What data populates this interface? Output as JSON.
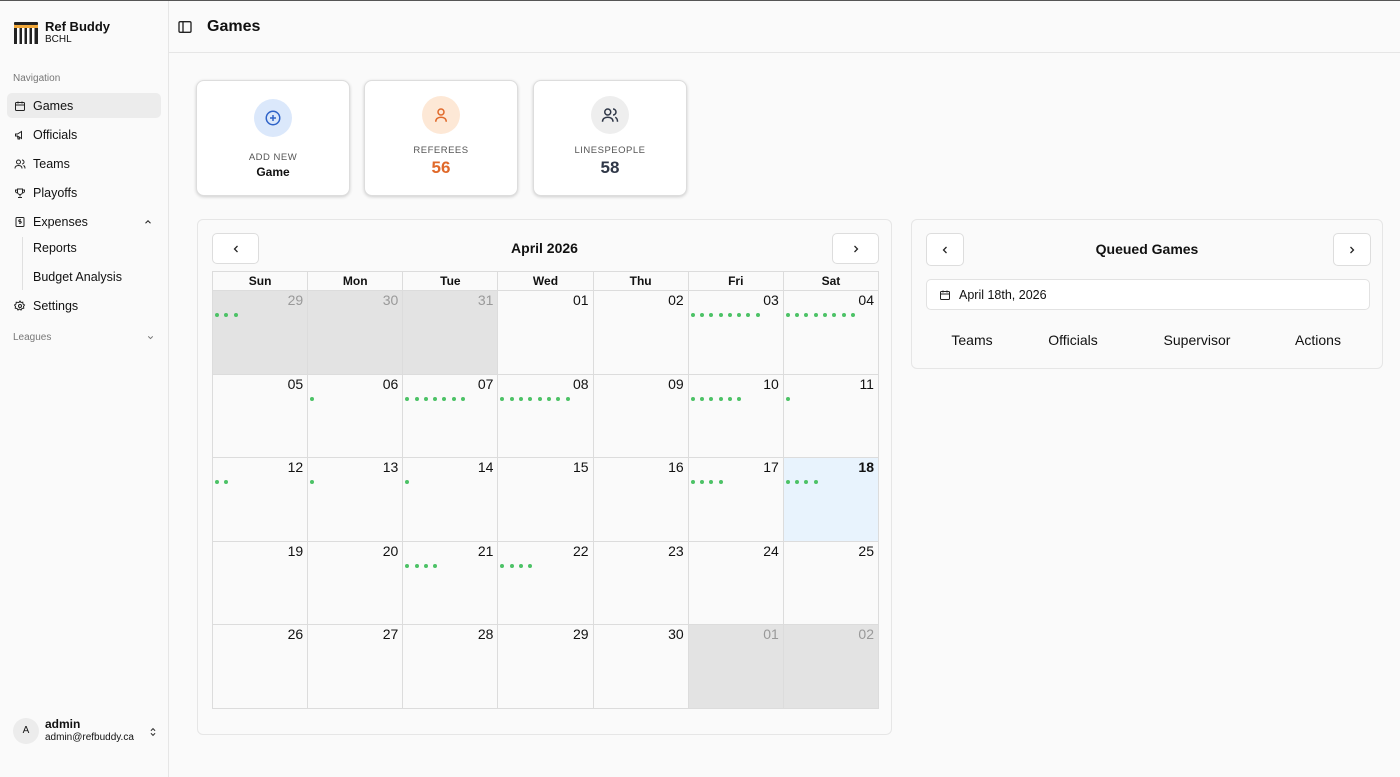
{
  "app": {
    "name": "Ref Buddy",
    "league": "BCHL"
  },
  "sidebar": {
    "heading": "Navigation",
    "items": [
      {
        "label": "Games",
        "icon": "calendar-icon",
        "active": true
      },
      {
        "label": "Officials",
        "icon": "megaphone-icon"
      },
      {
        "label": "Teams",
        "icon": "users-icon"
      },
      {
        "label": "Playoffs",
        "icon": "trophy-icon"
      },
      {
        "label": "Expenses",
        "icon": "receipt-icon",
        "expanded": true
      },
      {
        "label": "Settings",
        "icon": "gear-icon"
      }
    ],
    "sub_items": [
      "Reports",
      "Budget Analysis"
    ],
    "leagues_label": "Leagues"
  },
  "user": {
    "initial": "A",
    "name": "admin",
    "email": "admin@refbuddy.ca"
  },
  "header": {
    "title": "Games"
  },
  "stats": {
    "add": {
      "label": "ADD NEW",
      "sub": "Game"
    },
    "referees": {
      "label": "REFEREES",
      "value": "56",
      "color": "#e0692a"
    },
    "linespeople": {
      "label": "LINESPEOPLE",
      "value": "58",
      "color": "#2f3747"
    }
  },
  "calendar": {
    "title": "April 2026",
    "weekdays": [
      "Sun",
      "Mon",
      "Tue",
      "Wed",
      "Thu",
      "Fri",
      "Sat"
    ],
    "dot_color": "#4cc266",
    "weeks": [
      [
        {
          "d": "29",
          "m": true,
          "dots": 3
        },
        {
          "d": "30",
          "m": true,
          "dots": 0
        },
        {
          "d": "31",
          "m": true,
          "dots": 0
        },
        {
          "d": "01",
          "dots": 0
        },
        {
          "d": "02",
          "dots": 0
        },
        {
          "d": "03",
          "dots": 8
        },
        {
          "d": "04",
          "dots": 8
        }
      ],
      [
        {
          "d": "05",
          "dots": 0
        },
        {
          "d": "06",
          "dots": 1
        },
        {
          "d": "07",
          "dots": 7
        },
        {
          "d": "08",
          "dots": 8
        },
        {
          "d": "09",
          "dots": 0
        },
        {
          "d": "10",
          "dots": 6
        },
        {
          "d": "11",
          "dots": 1
        }
      ],
      [
        {
          "d": "12",
          "dots": 2
        },
        {
          "d": "13",
          "dots": 1
        },
        {
          "d": "14",
          "dots": 1
        },
        {
          "d": "15",
          "dots": 0
        },
        {
          "d": "16",
          "dots": 0
        },
        {
          "d": "17",
          "dots": 4
        },
        {
          "d": "18",
          "today": true,
          "dots": 4
        }
      ],
      [
        {
          "d": "19",
          "dots": 0
        },
        {
          "d": "20",
          "dots": 0
        },
        {
          "d": "21",
          "dots": 4
        },
        {
          "d": "22",
          "dots": 4
        },
        {
          "d": "23",
          "dots": 0
        },
        {
          "d": "24",
          "dots": 0
        },
        {
          "d": "25",
          "dots": 0
        }
      ],
      [
        {
          "d": "26",
          "dots": 0
        },
        {
          "d": "27",
          "dots": 0
        },
        {
          "d": "28",
          "dots": 0
        },
        {
          "d": "29",
          "dots": 0
        },
        {
          "d": "30",
          "dots": 0
        },
        {
          "d": "01",
          "m": true,
          "dots": 0
        },
        {
          "d": "02",
          "m": true,
          "dots": 0
        }
      ]
    ]
  },
  "queue": {
    "title": "Queued Games",
    "date": "April 18th, 2026",
    "columns": [
      "Teams",
      "Officials",
      "Supervisor",
      "Actions"
    ]
  }
}
